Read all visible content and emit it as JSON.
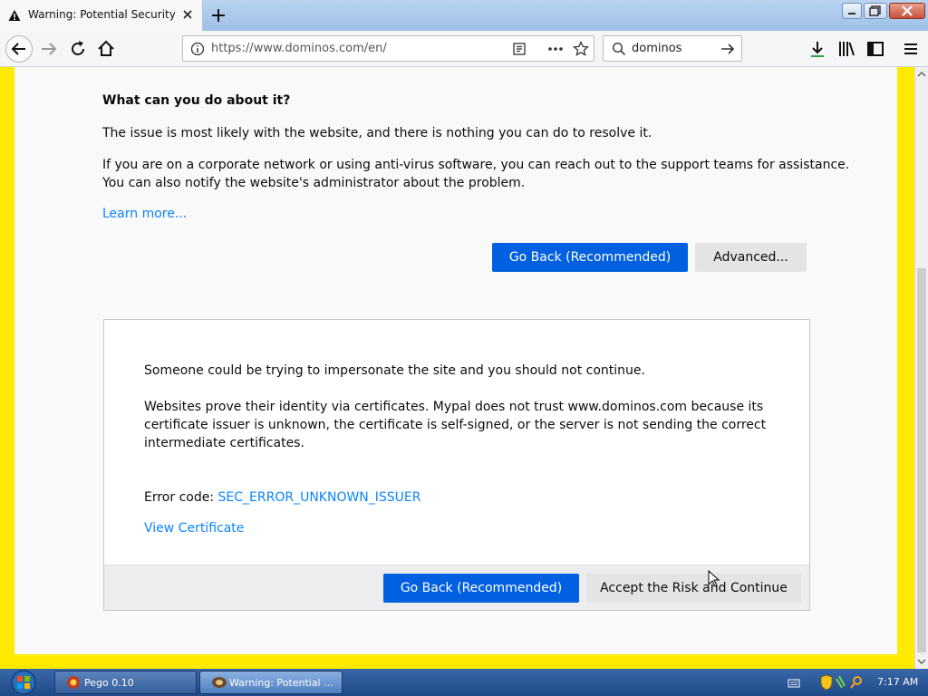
{
  "browser": {
    "tab_title": "Warning: Potential Security Risk Ahead",
    "url": "https://www.dominos.com/en/",
    "search_query": "dominos"
  },
  "page": {
    "what_heading": "What can you do about it?",
    "para1": "The issue is most likely with the website, and there is nothing you can do to resolve it.",
    "para2_line1": "If you are on a corporate network or using anti-virus software, you can reach out to the support teams for assistance.",
    "para2_line2": "You can also notify the website's administrator about the problem.",
    "learn_more": "Learn more...",
    "go_back_label": "Go Back (Recommended)",
    "advanced_label": "Advanced...",
    "adv_line1": "Someone could be trying to impersonate the site and you should not continue.",
    "adv_para_l1": "Websites prove their identity via certificates. Mypal does not trust www.dominos.com because its",
    "adv_para_l2": "certificate issuer is unknown, the certificate is self-signed, or the server is not sending the correct",
    "adv_para_l3": "intermediate certificates.",
    "error_code_label": "Error code: ",
    "error_code": "SEC_ERROR_UNKNOWN_ISSUER",
    "view_certificate": "View Certificate",
    "accept_label": "Accept the Risk and Continue"
  },
  "taskbar": {
    "task1_label": "Pego 0.10",
    "task2_label": "Warning: Potential ...",
    "time": "7:17 AM"
  },
  "colors": {
    "primary_button": "#0060df",
    "link": "#0a84ff",
    "page_border": "#ffea00"
  }
}
